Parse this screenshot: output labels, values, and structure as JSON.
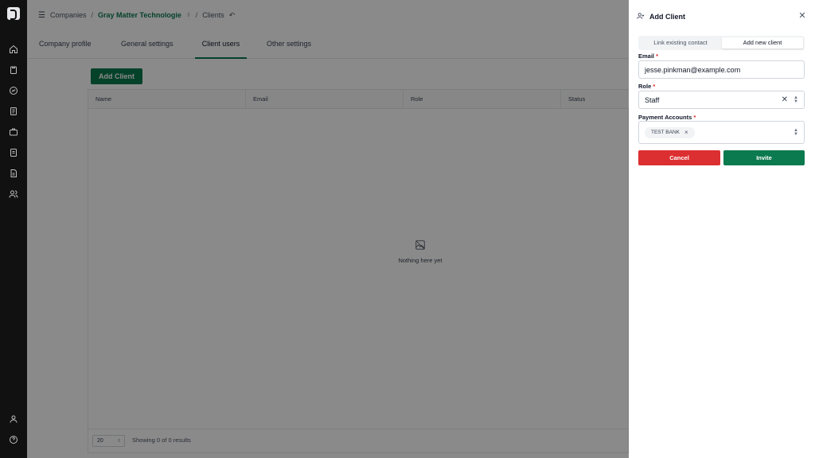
{
  "breadcrumb": {
    "companies": "Companies",
    "company": "Gray Matter Technologie",
    "clients": "Clients",
    "separator": "/"
  },
  "tabs": [
    {
      "label": "Company profile"
    },
    {
      "label": "General settings"
    },
    {
      "label": "Client users",
      "active": true
    },
    {
      "label": "Other settings"
    }
  ],
  "toolbar": {
    "add_client_label": "Add Client"
  },
  "table": {
    "columns": [
      "Name",
      "Email",
      "Role",
      "Status"
    ],
    "empty_text": "Nothing here yet",
    "page_size": "20",
    "showing": "Showing 0 of 0 results"
  },
  "drawer": {
    "title": "Add Client",
    "segments": [
      "Link existing contact",
      "Add new client"
    ],
    "active_segment": "Add new client",
    "email_label": "Email",
    "email_value": "jesse.pinkman@example.com",
    "role_label": "Role",
    "role_value": "Staff",
    "payment_label": "Payment Accounts",
    "payment_chips": [
      "TEST BANK"
    ],
    "required_mark": "*",
    "cancel_label": "Cancel",
    "invite_label": "Invite"
  },
  "colors": {
    "brand_green": "#0b7a4e",
    "danger_red": "#dc2f31",
    "sidebar_bg": "#111111"
  },
  "icons": [
    "logo",
    "home-icon",
    "clipboard-icon",
    "chart-icon",
    "document-icon",
    "briefcase-icon",
    "report-icon",
    "file-icon",
    "users-icon",
    "user-icon",
    "help-icon",
    "menu-icon",
    "undo-icon",
    "user-plus-icon",
    "close-icon",
    "empty-state-icon"
  ]
}
